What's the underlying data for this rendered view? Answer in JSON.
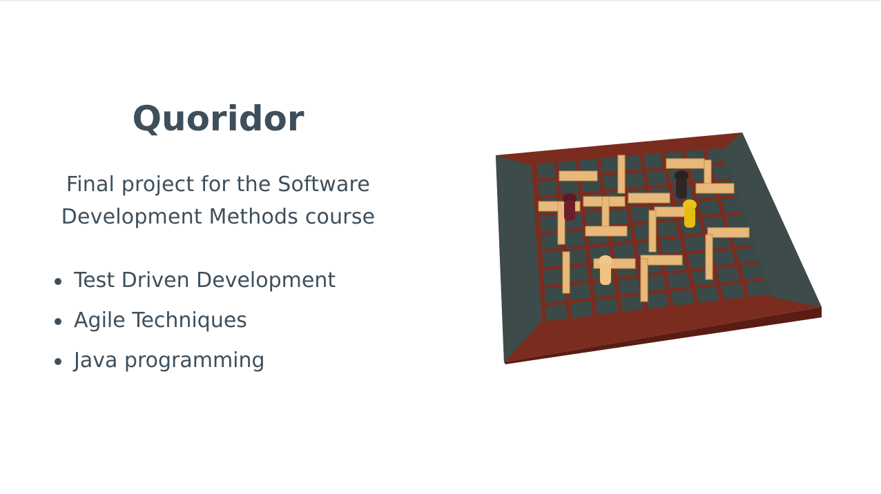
{
  "slide": {
    "title": "Quoridor",
    "subtitle_line1": "Final project for the Software",
    "subtitle_line2": "Development Methods course",
    "bullets": [
      {
        "label": "Test Driven Development"
      },
      {
        "label": "Agile Techniques"
      },
      {
        "label": "Java programming"
      }
    ]
  },
  "image": {
    "subject": "quoridor-board-game-photo",
    "colors": {
      "board_frame": "#7a2c1f",
      "board_squares": "#3a4a48",
      "walls": "#e8b97a",
      "text": "#3e4f5c"
    }
  }
}
